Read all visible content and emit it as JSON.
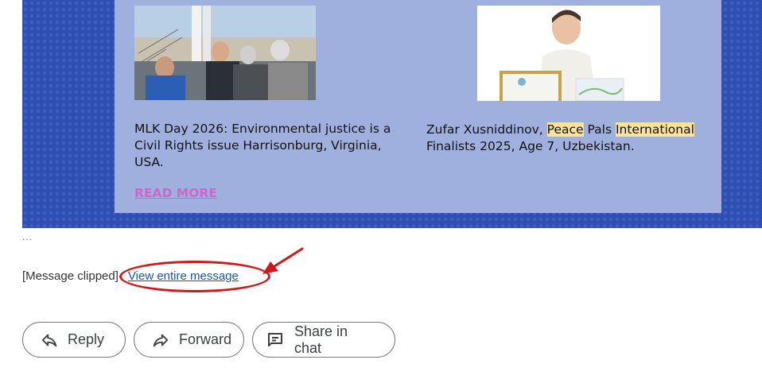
{
  "articles": [
    {
      "title": "MLK Day 2026: Environmental justice is a Civil Rights issue Harrisonburg, Virginia, USA.",
      "link_label": "READ MORE",
      "image": "photo-people-outdoors"
    },
    {
      "title_parts": [
        "Zufar Xusniddinov, ",
        "Peace",
        " Pals ",
        "International",
        " Finalists 2025, Age 7, Uzbekistan."
      ],
      "highlight_color": "#fbe29a",
      "image": "photo-boy-with-certificate"
    }
  ],
  "ellipsis": "...",
  "clip_notice": {
    "text": "[Message clipped]",
    "link": "View entire message"
  },
  "annotation": {
    "type": "red-ellipse-with-arrow",
    "color": "#d0171b"
  },
  "actions": [
    {
      "label": "Reply",
      "icon": "reply-icon"
    },
    {
      "label": "Forward",
      "icon": "forward-icon"
    },
    {
      "label": "Share in chat",
      "icon": "chat-icon"
    }
  ],
  "colors": {
    "newsletter_bg": "#2f4fb0",
    "card_bg": "#9fb0de",
    "read_more": "#cc66cc",
    "link": "#1a56b0"
  }
}
